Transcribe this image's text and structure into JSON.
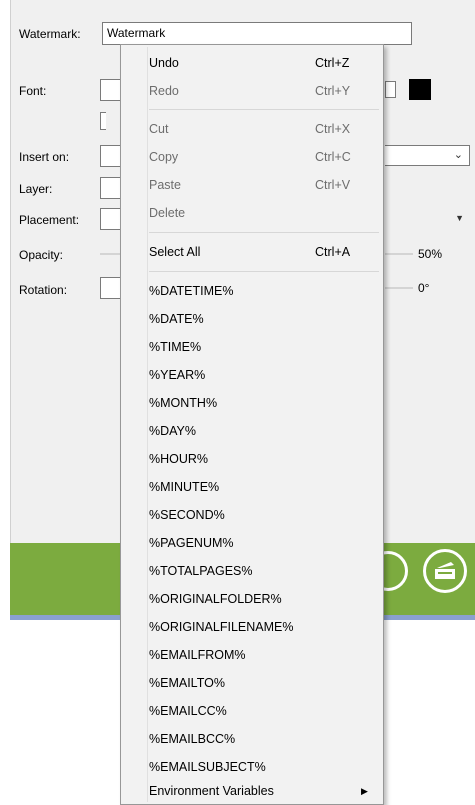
{
  "dialog": {
    "labels": {
      "watermark": "Watermark:",
      "font": "Font:",
      "insert_on": "Insert on:",
      "layer": "Layer:",
      "placement": "Placement:",
      "opacity": "Opacity:",
      "rotation": "Rotation:"
    },
    "watermark_value": "Watermark",
    "opacity_value": "50%",
    "rotation_value": "0°"
  },
  "context_menu": {
    "undo": {
      "label": "Undo",
      "shortcut": "Ctrl+Z"
    },
    "redo": {
      "label": "Redo",
      "shortcut": "Ctrl+Y"
    },
    "cut": {
      "label": "Cut",
      "shortcut": "Ctrl+X"
    },
    "copy": {
      "label": "Copy",
      "shortcut": "Ctrl+C"
    },
    "paste": {
      "label": "Paste",
      "shortcut": "Ctrl+V"
    },
    "delete": {
      "label": "Delete"
    },
    "select_all": {
      "label": "Select All",
      "shortcut": "Ctrl+A"
    },
    "variables": [
      "%DATETIME%",
      "%DATE%",
      "%TIME%",
      "%YEAR%",
      "%MONTH%",
      "%DAY%",
      "%HOUR%",
      "%MINUTE%",
      "%SECOND%",
      "%PAGENUM%",
      "%TOTALPAGES%",
      "%ORIGINALFOLDER%",
      "%ORIGINALFILENAME%",
      "%EMAILFROM%",
      "%EMAILTO%",
      "%EMAILCC%",
      "%EMAILBCC%",
      "%EMAILSUBJECT%"
    ],
    "environment_variables": {
      "label": "Environment Variables"
    }
  },
  "icons": {
    "submenu": "chevron-right-icon",
    "dropdown": "chevron-down-icon",
    "scan": "scanner-icon"
  },
  "colors": {
    "green_band": "#7cab3f",
    "blue_line": "#8aa0cf",
    "menu_bg": "#f2f2f2"
  }
}
